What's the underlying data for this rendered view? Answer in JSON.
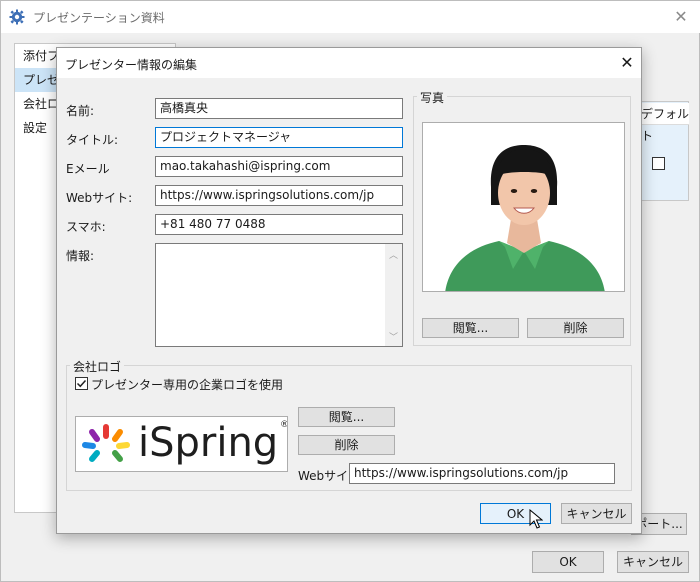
{
  "background_window": {
    "title": "プレゼンテーション資料",
    "list_items": [
      "添付ファ",
      "プレゼン",
      "会社ロゴ",
      "設定"
    ],
    "table_header": "デフォルト",
    "export_button": "ポート...",
    "ok_label": "OK",
    "cancel_label": "キャンセル"
  },
  "dialog": {
    "title": "プレゼンター情報の編集",
    "labels": {
      "name": "名前:",
      "title": "タイトル:",
      "email": "Eメール",
      "website": "Webサイト:",
      "phone": "スマホ:",
      "info": "情報:"
    },
    "values": {
      "name": "高橋真央",
      "title": "プロジェクトマネージャ",
      "email": "mao.takahashi@ispring.com",
      "website": "https://www.ispringsolutions.com/jp",
      "phone": "+81 480 77 0488",
      "info": ""
    },
    "photo": {
      "group_title": "写真",
      "browse_label": "閲覧...",
      "delete_label": "削除"
    },
    "company_logo": {
      "group_title": "会社ロゴ",
      "checkbox_label": "プレゼンター専用の企業ロゴを使用",
      "checkbox_checked": true,
      "logo_text": "iSpring",
      "logo_mark": "®",
      "browse_label": "閲覧...",
      "delete_label": "削除",
      "website_label": "Webサイト:",
      "website_value": "https://www.ispringsolutions.com/jp"
    },
    "ok_label": "OK",
    "cancel_label": "キャンセル"
  },
  "colors": {
    "accent": "#0078d7",
    "selection": "#cce4f7",
    "shirt": "#3f9a5a",
    "logo_text": "#1e1e1e"
  }
}
